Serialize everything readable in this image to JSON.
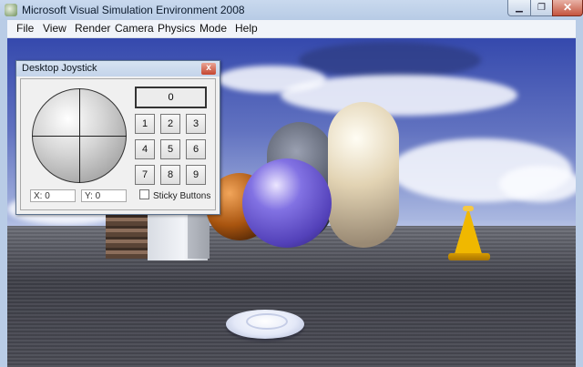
{
  "window": {
    "title": "Microsoft Visual Simulation Environment 2008",
    "minimize_glyph": "▁",
    "maximize_glyph": "❐",
    "close_glyph": "✕"
  },
  "menu": [
    "File",
    "View",
    "Render",
    "Camera",
    "Physics",
    "Mode",
    "Help"
  ],
  "joystick": {
    "title": "Desktop Joystick",
    "close_glyph": "x",
    "top_button": "0",
    "buttons": [
      "1",
      "2",
      "3",
      "4",
      "5",
      "6",
      "7",
      "8",
      "9"
    ],
    "x_readout": "X: 0",
    "y_readout": "Y: 0",
    "sticky_label": "Sticky Buttons",
    "sticky_checked": false
  },
  "scene": {
    "objects": [
      "brick-block",
      "white-box",
      "orange-sphere",
      "dark-capsule",
      "purple-sphere",
      "cream-capsule",
      "traffic-cone",
      "robot-puck"
    ],
    "colors": {
      "sky": "#5062b9",
      "cone": "#f0b800",
      "purple_sphere": "#8272e3"
    }
  }
}
